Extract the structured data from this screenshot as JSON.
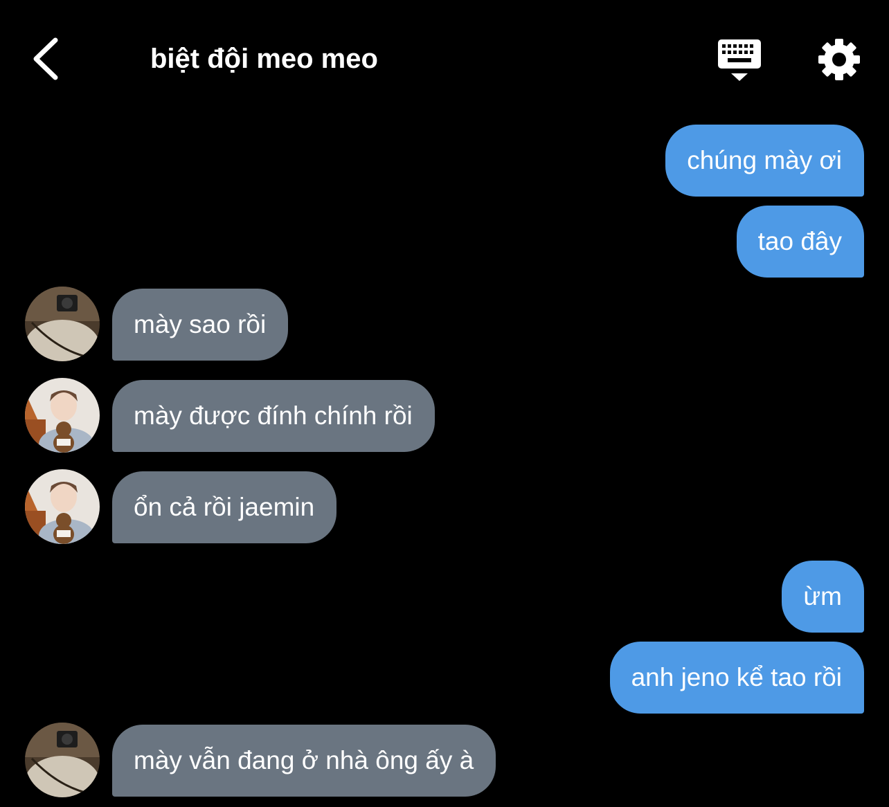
{
  "header": {
    "title": "biệt đội meo meo",
    "back_icon": "chevron-left-icon",
    "keyboard_icon": "keyboard-icon",
    "settings_icon": "gear-icon"
  },
  "colors": {
    "background": "#000000",
    "outgoing_bubble": "#4e9ae6",
    "incoming_bubble": "#6a7581",
    "text": "#ffffff"
  },
  "messages": [
    {
      "side": "outgoing",
      "text": "chúng mày ơi"
    },
    {
      "side": "outgoing",
      "text": "tao đây"
    },
    {
      "side": "incoming",
      "text": "mày sao rồi",
      "avatar": "avatar-camera"
    },
    {
      "side": "incoming",
      "text": "mày được đính chính rồi",
      "avatar": "avatar-teddy"
    },
    {
      "side": "incoming",
      "text": "ổn cả rồi jaemin",
      "avatar": "avatar-teddy"
    },
    {
      "side": "outgoing",
      "text": "ừm"
    },
    {
      "side": "outgoing",
      "text": "anh jeno kể tao rồi"
    },
    {
      "side": "incoming",
      "text": "mày vẫn đang ở nhà ông ấy à",
      "avatar": "avatar-camera"
    }
  ]
}
